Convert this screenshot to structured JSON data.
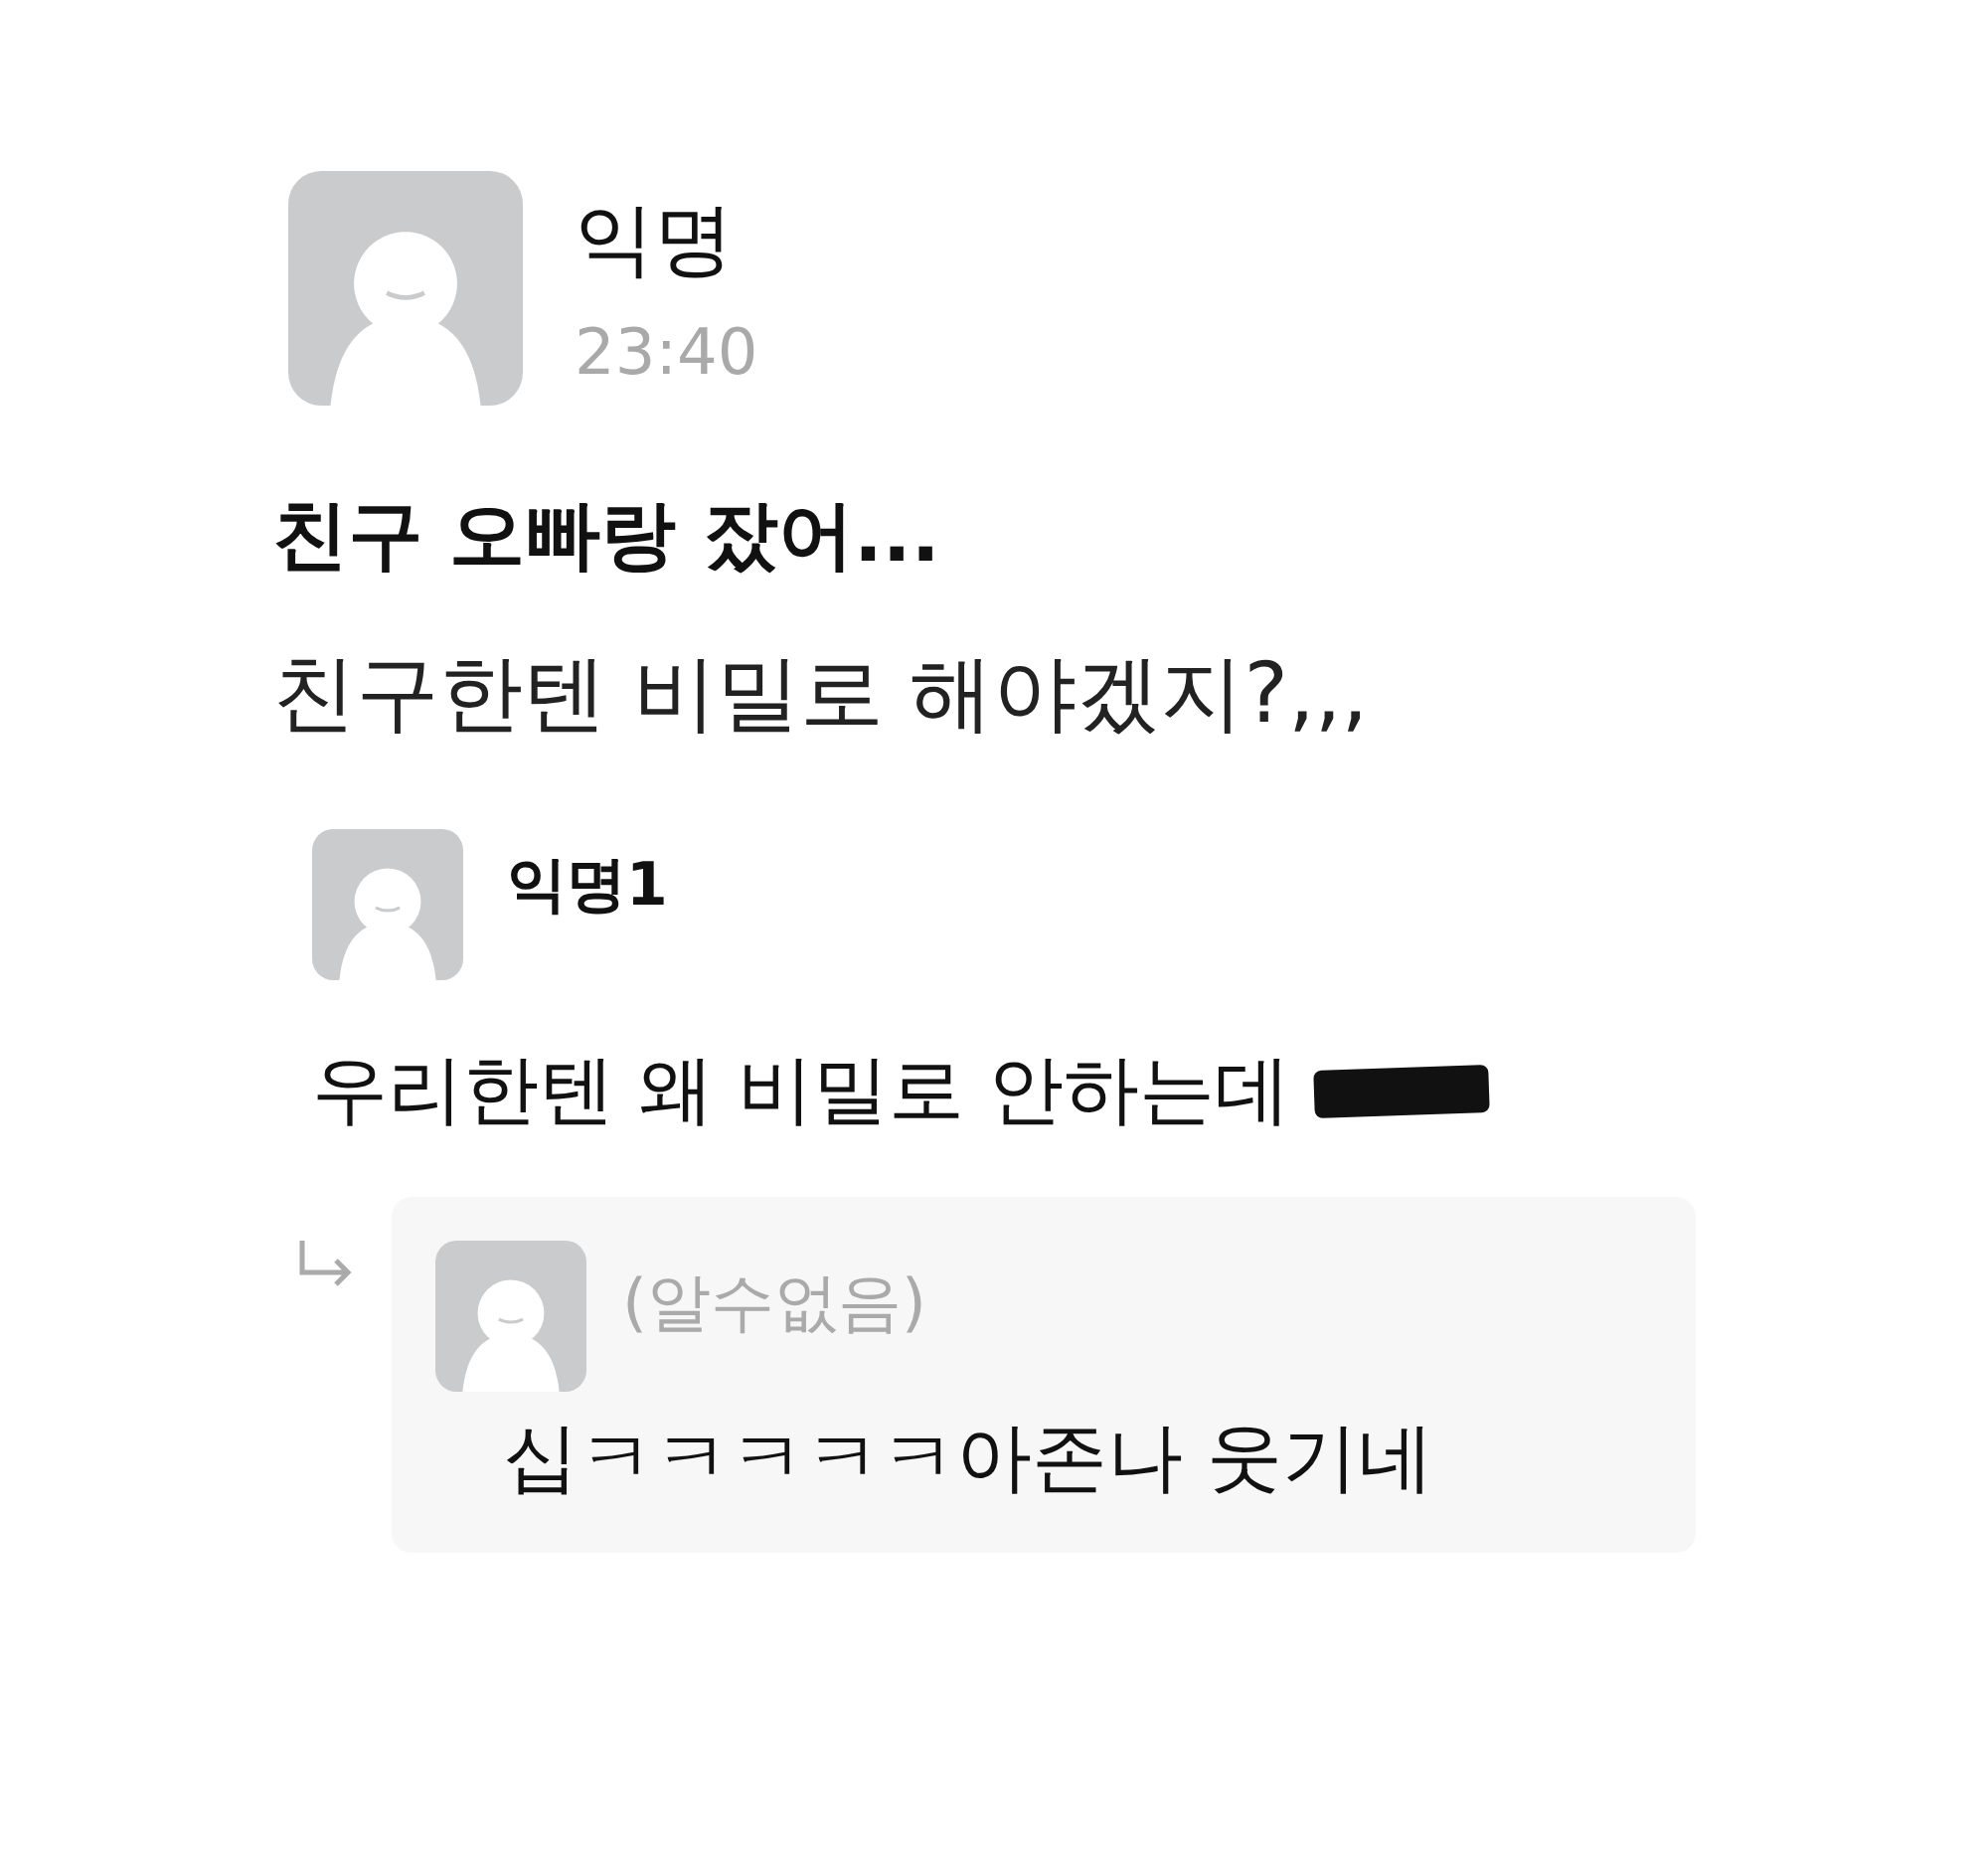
{
  "post": {
    "author": "익명",
    "time": "23:40",
    "title": "친구 오빠랑 잤어...",
    "body": "친구한텐 비밀로 해야겠지?,,,"
  },
  "comments": [
    {
      "author": "익명1",
      "text": "우리한텐 왜 비밀로 안하는데",
      "redacted": true,
      "replies": [
        {
          "author": "(알수없음)",
          "text": "십ㅋㅋㅋㅋㅋ아존나 웃기네"
        }
      ]
    }
  ]
}
